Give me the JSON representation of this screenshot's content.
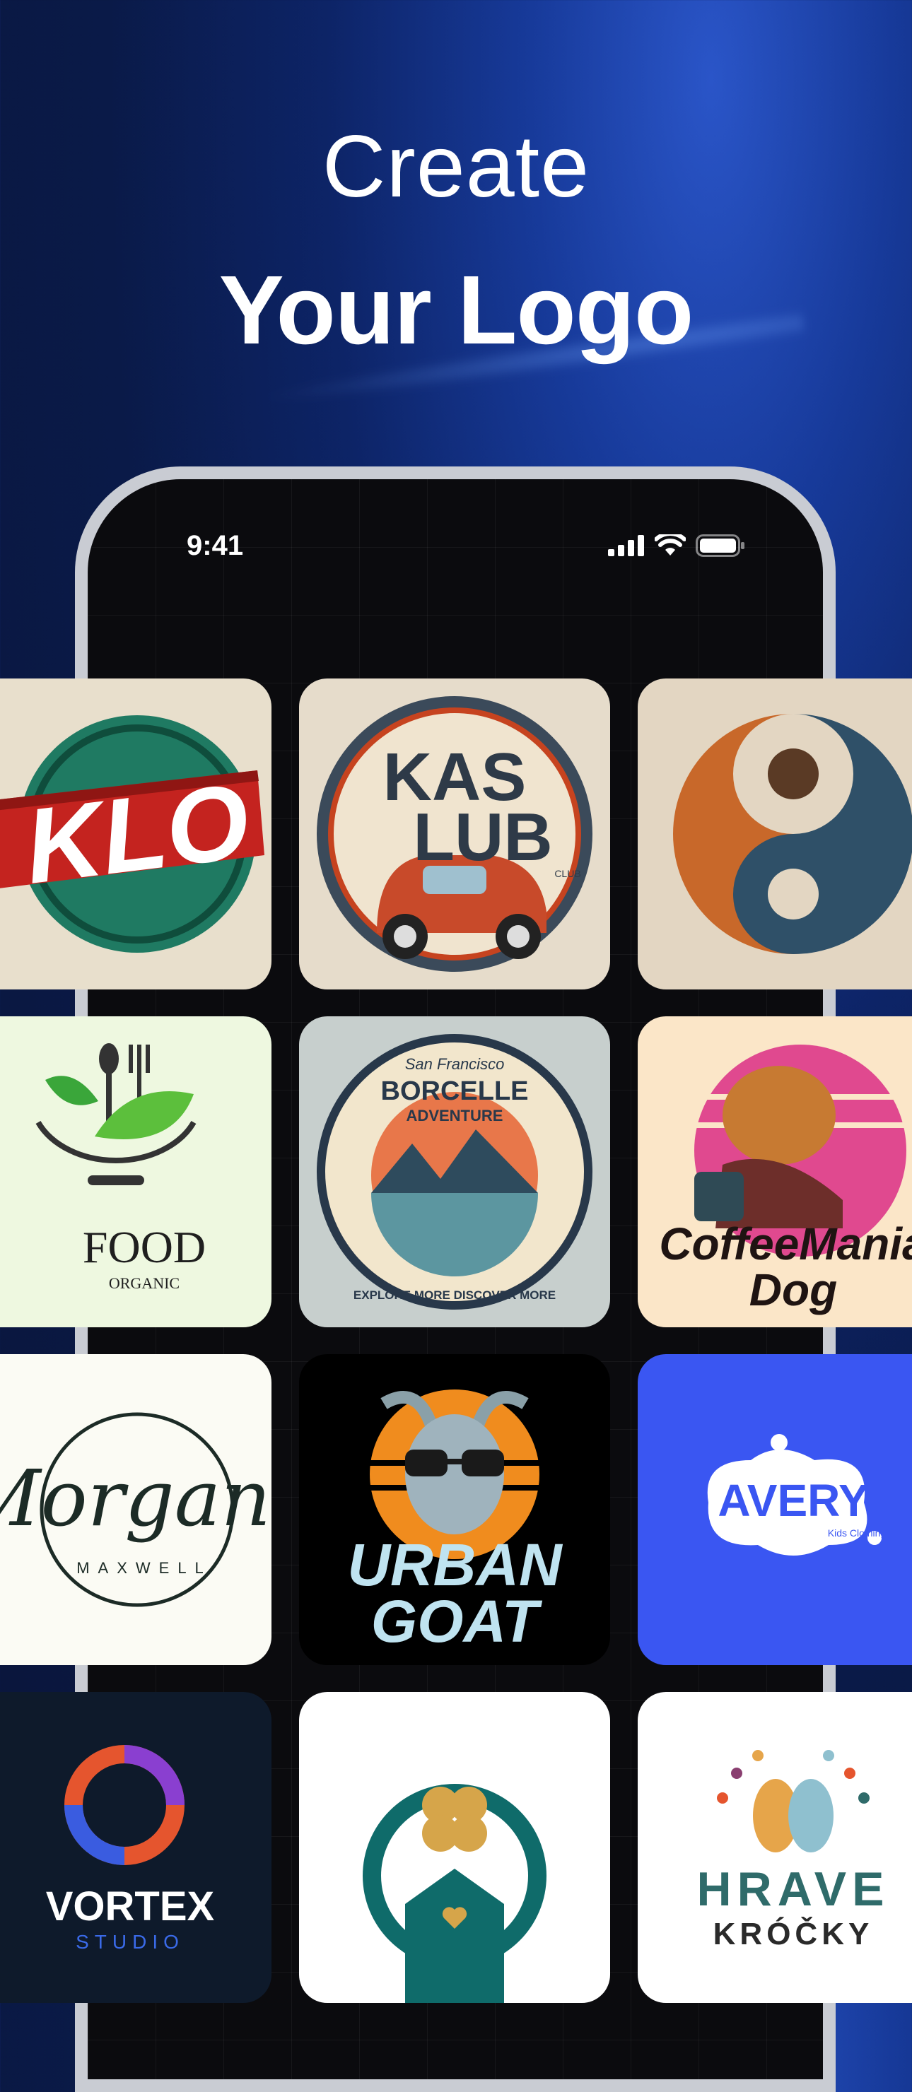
{
  "header": {
    "line1": "Create",
    "line2": "Your Logo"
  },
  "status_bar": {
    "time": "9:41",
    "icons": [
      "cellular-signal-icon",
      "wifi-icon",
      "battery-icon"
    ]
  },
  "logos": {
    "klo": {
      "text": "KLO"
    },
    "kas_lub": {
      "text1": "KAS",
      "text2": "LUB",
      "sub": "CLUB"
    },
    "swirl": {},
    "food": {
      "title": "FOOD",
      "sub": "ORGANIC"
    },
    "borcelle": {
      "top": "San Francisco",
      "title1": "BORCELLE",
      "title2": "ADVENTURE",
      "ring": "EXPLORE MORE DISCOVER MORE"
    },
    "coffee": {
      "line1": "CoffeeMania",
      "line2": "Dog"
    },
    "morgan": {
      "script": "Morgan",
      "sub": "MAXWELL"
    },
    "urban_goat": {
      "line1": "URBAN",
      "line2": "GOAT"
    },
    "avery": {
      "title": "AVERY",
      "sub": "Kids Clothing"
    },
    "vortex": {
      "title": "VORTEX",
      "sub": "STUDIO"
    },
    "house": {},
    "hrave": {
      "title": "HRAVE",
      "sub": "KRÓČKY"
    }
  },
  "colors": {
    "accent_blue": "#3a56f2",
    "phone_frame": "#c9ccd3"
  }
}
